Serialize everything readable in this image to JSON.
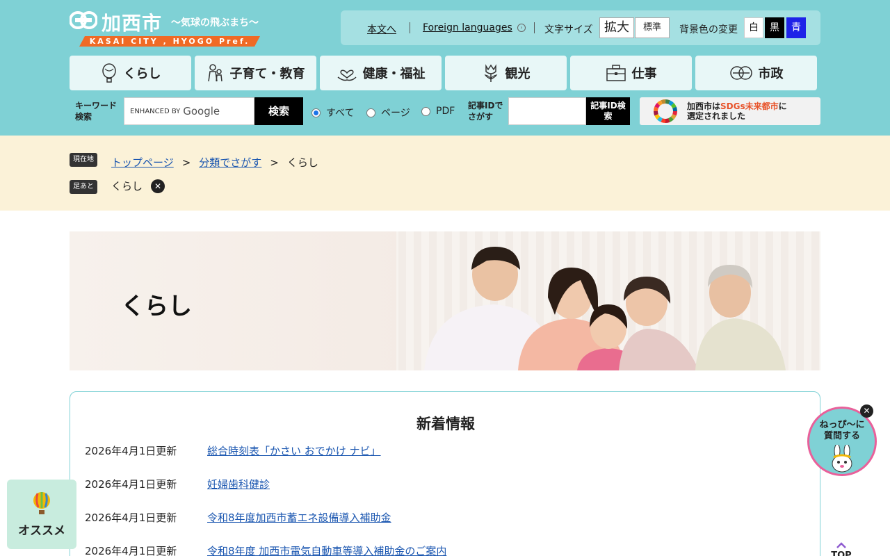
{
  "header": {
    "logo_name": "加西市",
    "logo_catch": "〜気球の飛ぶまち〜",
    "logo_band": "KASAI CITY , HYOGO Pref."
  },
  "util": {
    "honbun": "本文へ",
    "foreign": "Foreign languages",
    "font_size_label": "文字サイズ",
    "font_big": "拡大",
    "font_std": "標準",
    "bg_label": "背景色の変更",
    "bg_white": "白",
    "bg_black": "黒",
    "bg_blue": "青"
  },
  "nav": [
    {
      "label": "くらし",
      "icon": "balloon-icon"
    },
    {
      "label": "子育て・教育",
      "icon": "family-icon"
    },
    {
      "label": "健康・福祉",
      "icon": "heart-hand-icon"
    },
    {
      "label": "観光",
      "icon": "tulip-icon"
    },
    {
      "label": "仕事",
      "icon": "briefcase-icon"
    },
    {
      "label": "市政",
      "icon": "city-logo-icon"
    }
  ],
  "search": {
    "keyword_label": "キーワード検索",
    "enhanced_by": "ENHANCED BY",
    "google": "Google",
    "search_button": "検索",
    "radio_all": "すべて",
    "radio_page": "ページ",
    "radio_pdf": "PDF",
    "id_label": "記事IDでさがす",
    "id_button": "記事ID検索"
  },
  "sdgs": {
    "text_pre": "加西市は",
    "text_hl": "SDGs未来都市",
    "text_post": "に",
    "text_line2": "選定されました"
  },
  "breadcrumb": {
    "current_tag": "現在地",
    "top": "トップページ",
    "category": "分類でさがす",
    "current": "くらし",
    "history_tag": "足あと",
    "history_item": "くらし"
  },
  "hero": {
    "title": "くらし"
  },
  "news": {
    "title": "新着情報",
    "items": [
      {
        "date": "2026年4月1日更新",
        "title": "総合時刻表「かさい おでかけ ナビ」"
      },
      {
        "date": "2026年4月1日更新",
        "title": "妊婦歯科健診"
      },
      {
        "date": "2026年4月1日更新",
        "title": "令和8年度加西市蓄エネ設備導入補助金"
      },
      {
        "date": "2026年4月1日更新",
        "title": "令和8年度 加西市電気自動車等導入補助金のご案内"
      }
    ]
  },
  "widgets": {
    "osusume": "オススメ",
    "nep_line1": "ねっぴ〜に",
    "nep_line2": "質問する",
    "top": "TOP"
  },
  "colors": {
    "header_bg": "#7fd1d5",
    "breadcrumb_bg": "#fbf2d8",
    "accent_orange": "#f06a25",
    "link": "#1a56b0"
  }
}
